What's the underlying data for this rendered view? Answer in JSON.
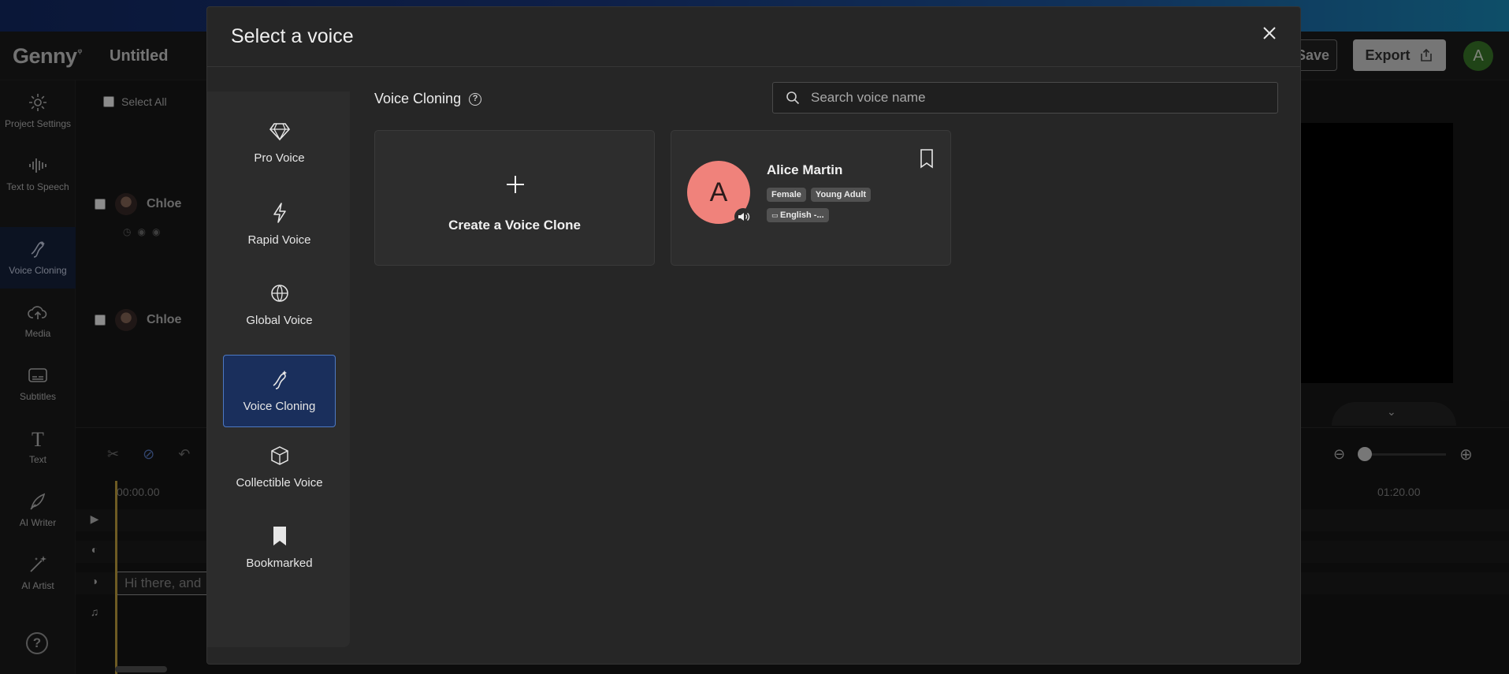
{
  "app": {
    "logo": "Genny",
    "project_title": "Untitled",
    "save_label": "Save",
    "export_label": "Export",
    "user_initial": "A"
  },
  "sidebar": {
    "items": [
      {
        "label": "Project Settings",
        "icon": "gear-icon"
      },
      {
        "label": "Text to Speech",
        "icon": "waveform-icon"
      },
      {
        "label": "Voice Cloning",
        "icon": "voice-clone-icon",
        "active": true
      },
      {
        "label": "Media",
        "icon": "cloud-upload-icon"
      },
      {
        "label": "Subtitles",
        "icon": "subtitles-icon"
      },
      {
        "label": "Text",
        "icon": "text-icon"
      },
      {
        "label": "AI Writer",
        "icon": "quill-icon"
      },
      {
        "label": "AI Artist",
        "icon": "magic-wand-icon"
      }
    ],
    "help_label": "?"
  },
  "editor": {
    "select_all_label": "Select All",
    "rows": [
      {
        "speaker": "Chloe"
      },
      {
        "speaker": "Chloe"
      }
    ]
  },
  "timeline": {
    "start_timecode": "00:00.00",
    "end_timecode": "01:20.00",
    "clip_text": "Hi there, and"
  },
  "modal": {
    "title": "Select a voice",
    "nav": [
      {
        "label": "Pro Voice",
        "icon": "diamond-icon"
      },
      {
        "label": "Rapid Voice",
        "icon": "lightning-icon"
      },
      {
        "label": "Global Voice",
        "icon": "globe-translate-icon"
      },
      {
        "label": "Voice Cloning",
        "icon": "voice-clone-icon",
        "active": true
      },
      {
        "label": "Collectible Voice",
        "icon": "cube-icon"
      },
      {
        "label": "Bookmarked",
        "icon": "bookmark-icon"
      }
    ],
    "section_title": "Voice Cloning",
    "search": {
      "placeholder": "Search voice name",
      "value": ""
    },
    "create_card_label": "Create a Voice Clone",
    "voices": [
      {
        "initial": "A",
        "name": "Alice Martin",
        "tags": [
          "Female",
          "Young Adult"
        ],
        "language_tag": "English -..."
      }
    ]
  },
  "colors": {
    "accent_active_bg": "#1a2f5c",
    "accent_active_border": "#4d79c4",
    "voice_avatar": "#f0827b",
    "modal_bg": "#262626"
  }
}
